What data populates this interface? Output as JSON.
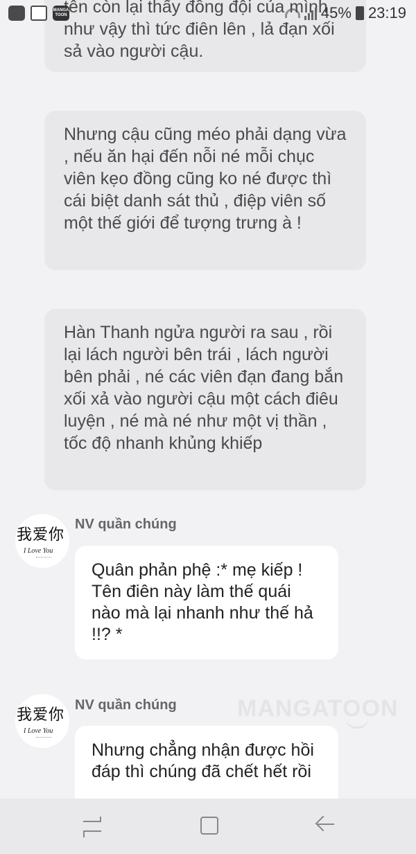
{
  "status_bar": {
    "battery": "45%",
    "time": "23:19",
    "app_icon_label": "MANGA TOON"
  },
  "messages": {
    "narration_1": "tên còn lại thấy đồng đội của mình như vậy thì tức điên lên , lả đạn xối sả vào người cậu.",
    "narration_2": "Nhưng cậu cũng méo phải dạng vừa , nếu ăn hại đến nỗi né mỗi chục viên kẹo đồng cũng ko né được thì cái biệt danh sát thủ , điệp viên số một thế giới để tượng trưng à !",
    "narration_3": "Hàn Thanh ngửa người ra sau , rồi lại lách người bên trái , lách người bên phải , né các viên đạn đang bắn xối xả vào người cậu một cách điêu luyện , né mà né như một vị thần , tốc độ nhanh khủng khiếp",
    "chat_1": {
      "speaker": "NV quần chúng",
      "avatar_text": "我爱你",
      "avatar_subtext": "I Love You",
      "text": "Quân phản phệ :* mẹ kiếp ! Tên điên này làm thế quái nào mà lại nhanh như thế hả !!? *"
    },
    "chat_2": {
      "speaker": "NV quần chúng",
      "avatar_text": "我爱你",
      "avatar_subtext": "I Love You",
      "text": "Nhưng chẳng nhận được hồi đáp thì chúng đã chết hết rồi"
    }
  },
  "watermark": "MANGATOON",
  "nav_bar": {
    "recent_icon": "recent-apps-icon",
    "home_icon": "home-icon",
    "back_icon": "back-arrow-icon"
  }
}
